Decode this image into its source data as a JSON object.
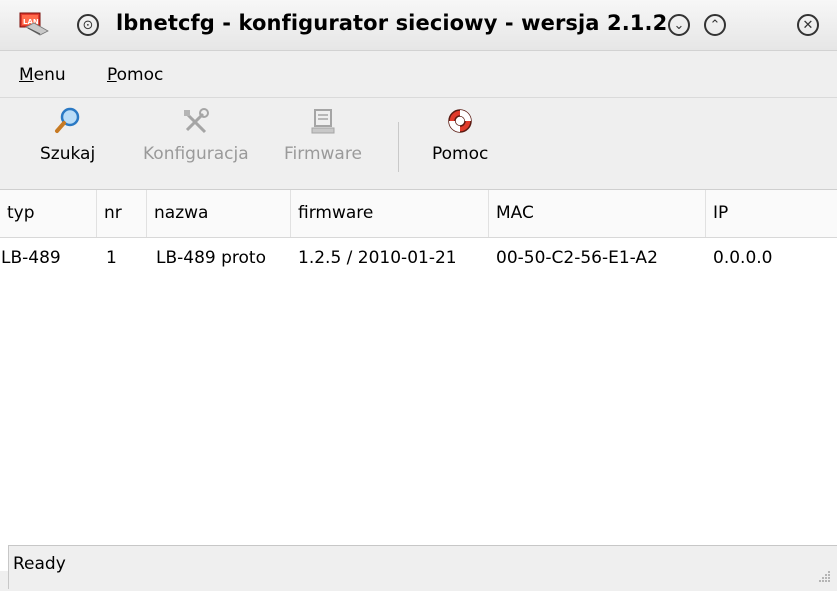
{
  "window": {
    "title": "lbnetcfg - konfigurator sieciowy - wersja 2.1.2",
    "app_icon": "network-app-icon",
    "buttons": {
      "menu": "⊙",
      "minimize": "⌄",
      "maximize": "⌃",
      "close": "✕"
    }
  },
  "menubar": {
    "items": [
      {
        "label": "Menu",
        "mnemonic": "M",
        "rest": "enu"
      },
      {
        "label": "Pomoc",
        "mnemonic": "P",
        "rest": "omoc"
      }
    ]
  },
  "toolbar": {
    "search_label": "Szukaj",
    "config_label": "Konfiguracja",
    "firmware_label": "Firmware",
    "help_label": "Pomoc"
  },
  "table": {
    "columns": [
      "typ",
      "nr",
      "nazwa",
      "firmware",
      "MAC",
      "IP"
    ],
    "rows": [
      [
        "LB-489",
        "1",
        "LB-489 proto",
        "1.2.5 / 2010-01-21",
        "00-50-C2-56-E1-A2",
        "0.0.0.0"
      ]
    ]
  },
  "status": {
    "text": "Ready"
  }
}
